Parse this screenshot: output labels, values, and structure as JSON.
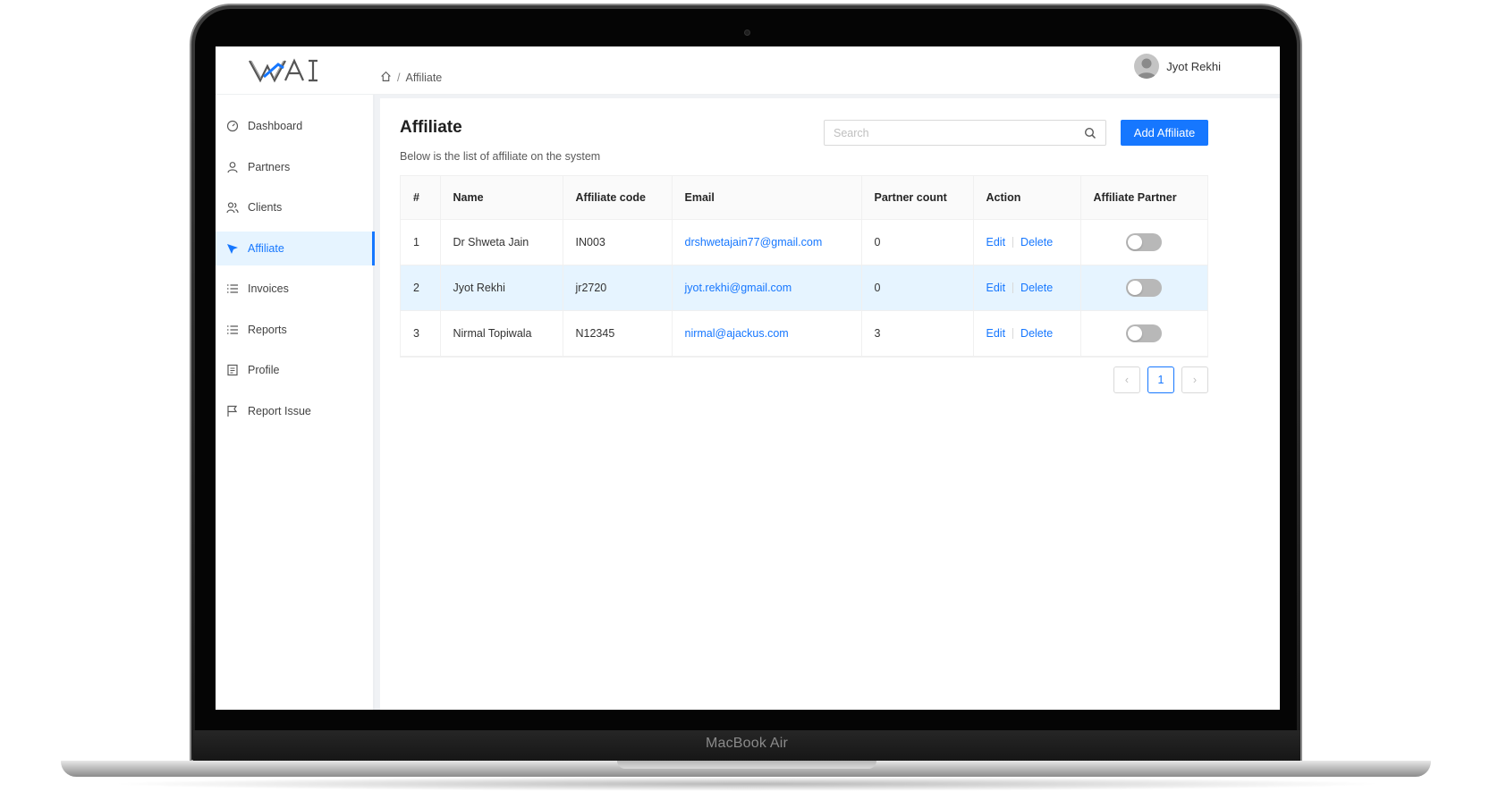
{
  "device": {
    "brand_label": "MacBook Air"
  },
  "header": {
    "breadcrumb": {
      "current": "Affiliate",
      "separator": "/"
    },
    "user_name": "Jyot Rekhi"
  },
  "sidebar": {
    "items": [
      {
        "label": "Dashboard",
        "icon": "dashboard-icon"
      },
      {
        "label": "Partners",
        "icon": "user-icon"
      },
      {
        "label": "Clients",
        "icon": "users-icon"
      },
      {
        "label": "Affiliate",
        "icon": "send-icon",
        "active": true
      },
      {
        "label": "Invoices",
        "icon": "list-icon"
      },
      {
        "label": "Reports",
        "icon": "list-icon"
      },
      {
        "label": "Profile",
        "icon": "profile-icon"
      },
      {
        "label": "Report Issue",
        "icon": "flag-icon"
      }
    ]
  },
  "main": {
    "title": "Affiliate",
    "subtitle": "Below is the list of affiliate on the system",
    "search": {
      "placeholder": "Search",
      "value": ""
    },
    "add_button": "Add Affiliate",
    "table": {
      "columns": [
        "#",
        "Name",
        "Affiliate code",
        "Email",
        "Partner count",
        "Action",
        "Affiliate Partner"
      ],
      "rows": [
        {
          "index": "1",
          "name": "Dr Shweta Jain",
          "code": "IN003",
          "email": "drshwetajain77@gmail.com",
          "partner_count": "0",
          "edit": "Edit",
          "delete": "Delete",
          "affiliate_partner": false
        },
        {
          "index": "2",
          "name": "Jyot Rekhi",
          "code": "jr2720",
          "email": "jyot.rekhi@gmail.com",
          "partner_count": "0",
          "edit": "Edit",
          "delete": "Delete",
          "affiliate_partner": false
        },
        {
          "index": "3",
          "name": "Nirmal Topiwala",
          "code": "N12345",
          "email": "nirmal@ajackus.com",
          "partner_count": "3",
          "edit": "Edit",
          "delete": "Delete",
          "affiliate_partner": false
        }
      ]
    },
    "pagination": {
      "prev": "‹",
      "current_page": "1",
      "next": "›"
    }
  },
  "colors": {
    "accent": "#1677ff",
    "active_bg": "#e6f4ff",
    "toggle_off": "#b8b8b8"
  }
}
